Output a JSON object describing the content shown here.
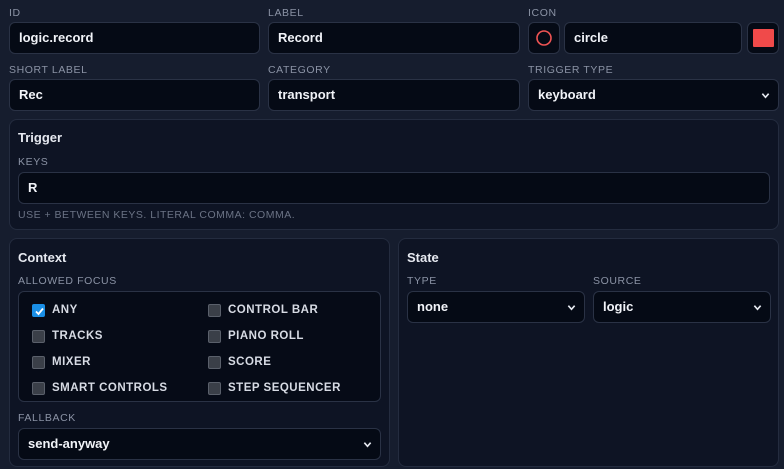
{
  "fields": {
    "id": {
      "label": "ID",
      "value": "logic.record"
    },
    "label": {
      "label": "LABEL",
      "value": "Record"
    },
    "icon": {
      "label": "ICON",
      "value": "circle",
      "glyph": "circle-icon",
      "glyph_color": "#f05454",
      "swatch_color": "#f04a4a"
    },
    "short_label": {
      "label": "SHORT LABEL",
      "value": "Rec"
    },
    "category": {
      "label": "CATEGORY",
      "value": "transport"
    },
    "trigger_type": {
      "label": "TRIGGER TYPE",
      "value": "keyboard"
    }
  },
  "trigger": {
    "title": "Trigger",
    "keys_label": "KEYS",
    "keys_value": "R",
    "hint": "USE + BETWEEN KEYS. LITERAL COMMA: COMMA."
  },
  "context": {
    "title": "Context",
    "allowed_focus_label": "ALLOWED FOCUS",
    "focus_items": [
      {
        "label": "ANY",
        "checked": true
      },
      {
        "label": "CONTROL BAR",
        "checked": false
      },
      {
        "label": "TRACKS",
        "checked": false
      },
      {
        "label": "PIANO ROLL",
        "checked": false
      },
      {
        "label": "MIXER",
        "checked": false
      },
      {
        "label": "SCORE",
        "checked": false
      },
      {
        "label": "SMART CONTROLS",
        "checked": false
      },
      {
        "label": "STEP SEQUENCER",
        "checked": false
      }
    ],
    "fallback_label": "FALLBACK",
    "fallback_value": "send-anyway"
  },
  "state": {
    "title": "State",
    "type_label": "TYPE",
    "type_value": "none",
    "source_label": "SOURCE",
    "source_value": "logic"
  },
  "colors": {
    "checkbox_accent": "#1a8fe6",
    "background": "#161d2e",
    "panel": "#0e1424"
  }
}
